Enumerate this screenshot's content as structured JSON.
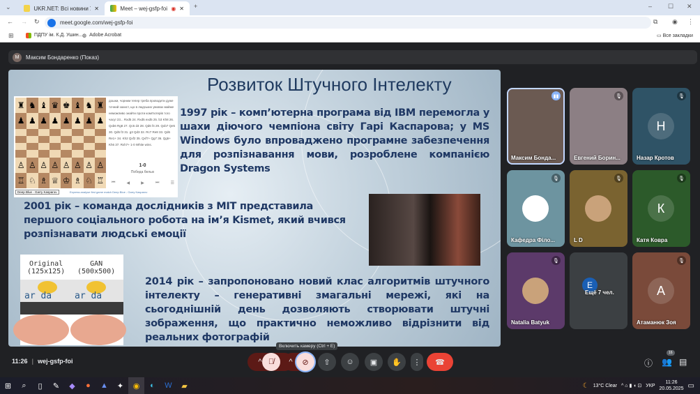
{
  "browser": {
    "tabs": [
      {
        "title": "UKR.NET: Всі новини України, ..."
      },
      {
        "title": "Meet – wej-gsfp-foi"
      }
    ],
    "new_tab": "+",
    "url": "meet.google.com/wej-gsfp-foi",
    "bookmarks": [
      "ПДПУ ім. К.Д. Ушин...",
      "Adobe Acrobat"
    ],
    "all_bookmarks": "Все закладки"
  },
  "meet": {
    "presenter_initial": "М",
    "presenter": "Максим Бондаренко (Показ)",
    "time": "11:26",
    "code": "wej-gsfp-foi",
    "tooltip": "Включить камеру (Ctrl + E)",
    "participants_count": "16",
    "tiles": [
      {
        "name": "Максим Бонда...",
        "bg": "#6b5a52",
        "speaking": true
      },
      {
        "name": "Евгений Борин...",
        "bg": "#8c7f84"
      },
      {
        "name": "Назар Кротов",
        "letter": "Н",
        "bg": "#2f5366"
      },
      {
        "name": "Кафедра Філо...",
        "bg": "#6d94a0"
      },
      {
        "name": "L D",
        "bg": "#7a6330"
      },
      {
        "name": "Катя Ковра",
        "letter": "К",
        "bg": "#2c5a2a"
      },
      {
        "name": "Natalia Batyuk",
        "bg": "#5c3a6a"
      },
      {
        "name": "Ещё 7 чел.",
        "letter": "E",
        "bg": "#3c4043"
      },
      {
        "name": "Атаманюк Зоя",
        "letter": "А",
        "bg": "#7a4a3a"
      }
    ]
  },
  "slide": {
    "title": "Розвиток Штучного Інтелекту",
    "p1997": "1997 рік – комп’ютерна програма від IBM перемогла у шахи діючого чемпіона світу Гарі Каспарова; у MS Windows було впроваджено програмне забезпечення для розпізнавання мови, розроблене компанією Dragon Systems",
    "p2001": "2001 рік – команда дослідників з MIT представила першого соціального робота на ім’я Kismet, який вчився розпізнавати людські емоції",
    "p2014": "2014 рік – запропоновано новий клас алгоритмів штучного інтелекту – генеративні змагальні мережі, які на сьогоднішній день дозволяють створювати штучні зображення, що практично неможливо відрізнити від реальних фотографій",
    "chess": {
      "rows": [
        "♜♞♝♛♚♝♞♜",
        "♟♟♟♟♟♟♟♟",
        "        ",
        "        ",
        "        ",
        "        ",
        "♙♙♙♙♙♙♙♙",
        "♖♘♗♕♔♗♘♖"
      ],
      "moves": "дошки, чорним тепер треба проводити дуже точний захист, що в людських умовах майже неможливо знайти проти комп'ютерів того часу! 23... Rxd5 24. Rxd5 exd5 25. b3 Kh8 26. Qxb6 Rg8 27. Qc5 d4 28. Qd6 f4 29. Qxb7 Qe5 30. Qd5 f3 31. g3 Qd3 32. Rc7 Re8 33. Qd6 Re1+ 34. Kh2 Qxf2 35. Qxf7+ Qg7 36. Qg5+ Kh6 37. Rxh7+ 1-0 White wins.",
      "result": "1-0",
      "result_label": "Победа белых",
      "select": "Deep Blue - Garry Kasparov",
      "link": "Express analyse first game match Deep Blue - Garry Kasparov"
    },
    "gan": {
      "original": "Original",
      "original_size": "(125x125)",
      "gan": "GAN",
      "gan_size": "(500x500)",
      "sample": "ar da"
    }
  },
  "taskbar": {
    "weather": "13°C  Clear",
    "lang": "УКР",
    "time": "11:26",
    "date": "20.05.2025"
  }
}
